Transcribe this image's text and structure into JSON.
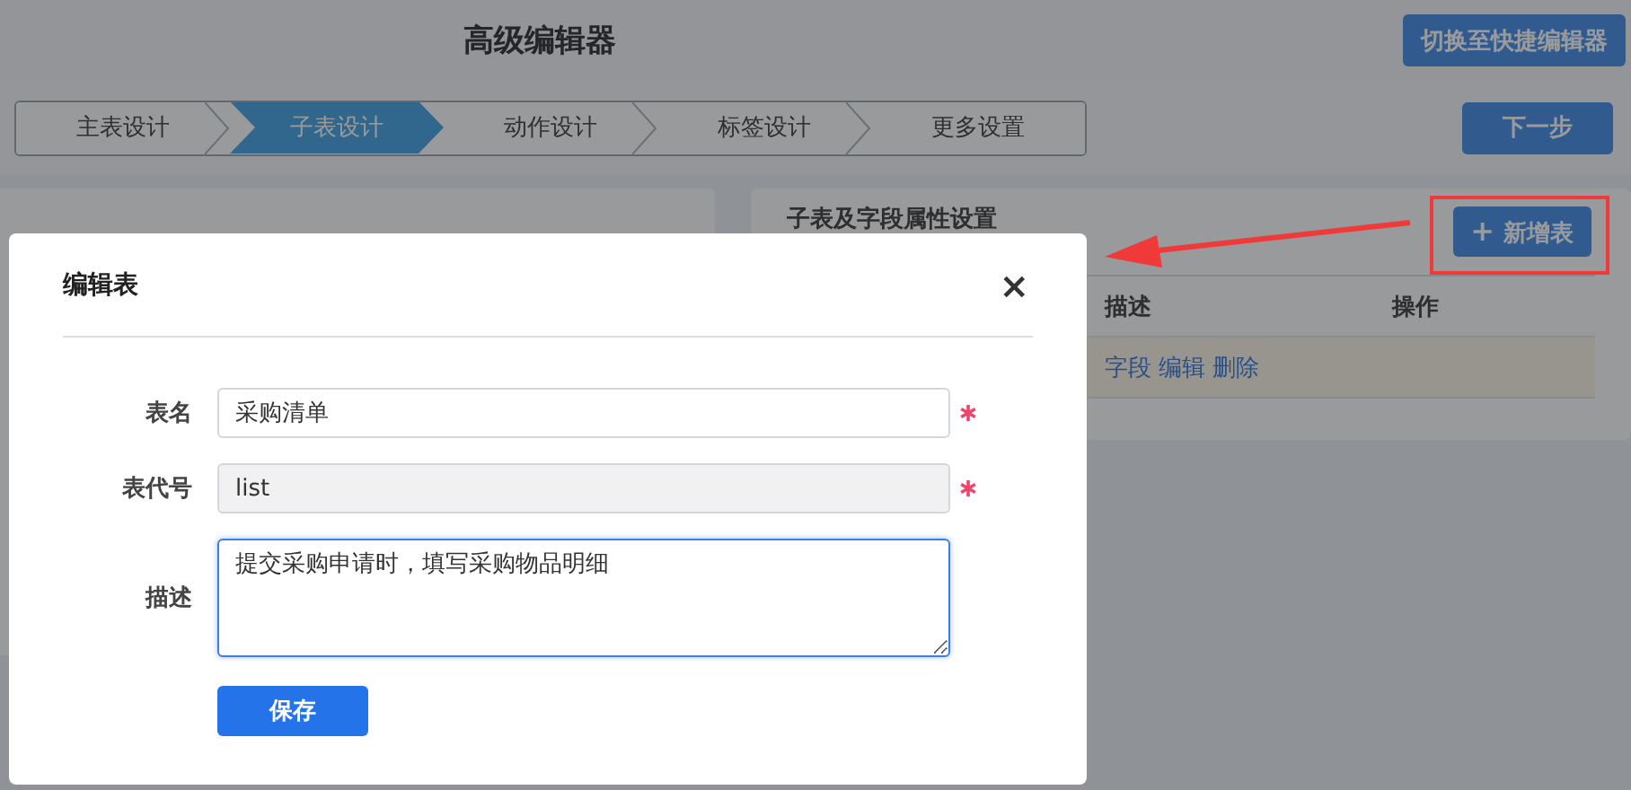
{
  "header": {
    "title": "高级编辑器",
    "switch_button": "切换至快捷编辑器"
  },
  "steps": [
    {
      "label": "主表设计",
      "selected": false
    },
    {
      "label": "子表设计",
      "selected": true
    },
    {
      "label": "动作设计",
      "selected": false
    },
    {
      "label": "标签设计",
      "selected": false
    },
    {
      "label": "更多设置",
      "selected": false
    }
  ],
  "next_button": "下一步",
  "panel": {
    "title": "子表及字段属性设置",
    "add_button": {
      "icon": "+",
      "label": "新增表"
    },
    "table": {
      "columns": [
        "描述",
        "操作"
      ],
      "rows": [
        {
          "selected": true,
          "actions": [
            "字段",
            "编辑",
            "删除"
          ]
        }
      ]
    }
  },
  "dialog": {
    "title": "编辑表",
    "close": "×",
    "fields": [
      {
        "kind": "input",
        "label": "表名",
        "value": "采购清单",
        "required": true,
        "disabled": false
      },
      {
        "kind": "input",
        "label": "表代号",
        "value": "list",
        "required": true,
        "disabled": true
      },
      {
        "kind": "textarea",
        "label": "描述",
        "value": "提交采购申请时，填写采购物品明细",
        "required": false,
        "disabled": false
      }
    ],
    "save_button": "保存"
  }
}
